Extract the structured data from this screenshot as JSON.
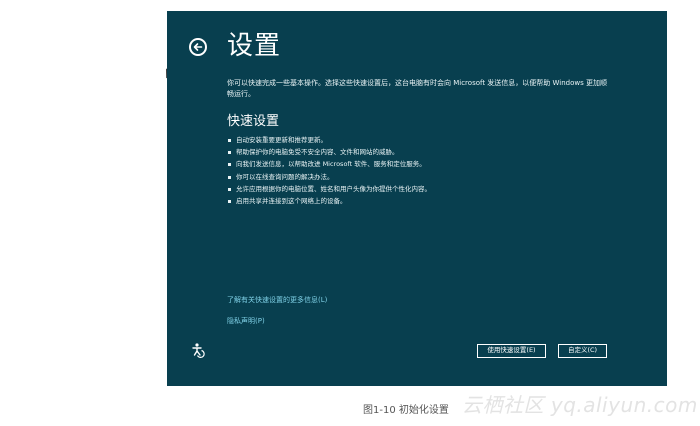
{
  "screen": {
    "title": "设置",
    "description": "你可以快速完成一些基本操作。选择这些快速设置后，这台电脑有时会向 Microsoft 发送信息，以便帮助 Windows 更加顺畅运行。",
    "subtitle": "快速设置",
    "items": [
      "自动安装重要更新和推荐更新。",
      "帮助保护你的电脑免受不安全内容、文件和网站的威胁。",
      "向我们发送信息，以帮助改进 Microsoft 软件、服务和定位服务。",
      "你可以在线查询问题的解决办法。",
      "允许应用根据你的电脑位置、姓名和用户头像为你提供个性化内容。",
      "启用共享并连接到这个网络上的设备。"
    ],
    "learn_more_link": "了解有关快速设置的更多信息(L)",
    "privacy_link": "隐私声明(P)",
    "express_button": "使用快速设置(E)",
    "custom_button": "自定义(C)"
  },
  "caption": "图1-10 初始化设置",
  "watermark": "云栖社区 yq.aliyun.com",
  "icons": {
    "back": "back-arrow-circle-icon",
    "ease_of_access": "ease-of-access-icon",
    "cursor": "mouse-cursor-icon"
  },
  "colors": {
    "screen_bg": "#083f4f",
    "link": "#7fd0e6",
    "text": "#ffffff"
  }
}
